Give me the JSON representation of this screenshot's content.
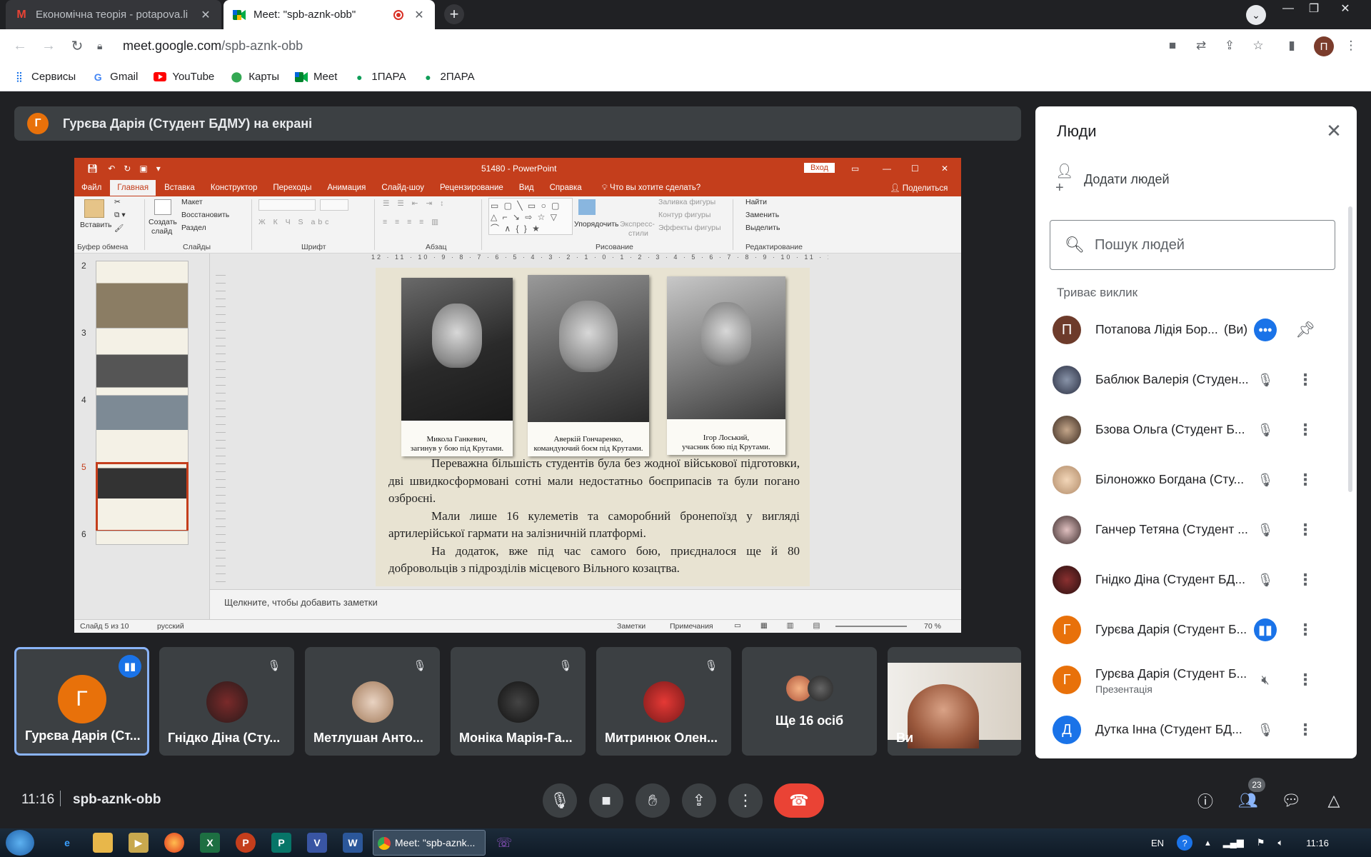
{
  "browser": {
    "tabs": [
      {
        "title": "Економічна теорія - potapova.li",
        "icon": "gmail-icon",
        "active": false
      },
      {
        "title": "Meet: \"spb-aznk-obb\"",
        "icon": "meet-icon",
        "active": true
      }
    ],
    "new_tab": "+",
    "url_host": "meet.google.com",
    "url_path": "/spb-aznk-obb",
    "profile_initial": "П",
    "bookmarks": [
      {
        "label": "Сервисы",
        "icon": "apps-grid-icon"
      },
      {
        "label": "Gmail",
        "icon": "google-icon"
      },
      {
        "label": "YouTube",
        "icon": "youtube-icon"
      },
      {
        "label": "Карты",
        "icon": "maps-pin-icon"
      },
      {
        "label": "Meet",
        "icon": "meet-icon"
      },
      {
        "label": "1ПАРА",
        "icon": "hangouts-icon"
      },
      {
        "label": "2ПАРА",
        "icon": "hangouts-icon"
      }
    ]
  },
  "meet": {
    "presenter_initial": "Г",
    "presenter_banner": "Гурєва Дарія (Студент БДМУ) на екрані",
    "time": "11:16",
    "code": "spb-aznk-obb",
    "people_count": "23",
    "tiles": [
      {
        "name": "Гурєва Дарія (Ст...",
        "initial": "Г",
        "speaking": true
      },
      {
        "name": "Гнідко Діна (Сту...",
        "muted": true
      },
      {
        "name": "Метлушан Анто...",
        "muted": true
      },
      {
        "name": "Моніка Марія-Га...",
        "muted": true
      },
      {
        "name": "Митринюк Олен...",
        "muted": true
      },
      {
        "name": "Ще 16 осіб"
      },
      {
        "name": "Ви"
      }
    ]
  },
  "ppt": {
    "window_title": "51480 - PowerPoint",
    "signin": "Вход",
    "menu": [
      "Файл",
      "Главная",
      "Вставка",
      "Конструктор",
      "Переходы",
      "Анимация",
      "Слайд-шоу",
      "Рецензирование",
      "Вид",
      "Справка"
    ],
    "tellme": "Что вы хотите сделать?",
    "share": "Поделиться",
    "ribbon": {
      "paste": "Вставить",
      "clipboard": "Буфер обмена",
      "new_slide_1": "Создать",
      "new_slide_2": "слайд",
      "layout": "Макет",
      "reset": "Восстановить",
      "section": "Раздел",
      "slides": "Слайды",
      "font": "Шрифт",
      "paragraph": "Абзац",
      "arrange": "Упорядочить",
      "quick_styles_1": "Экспресс-",
      "quick_styles_2": "стили",
      "fill": "Заливка фигуры",
      "outline": "Контур фигуры",
      "effects": "Эффекты фигуры",
      "drawing": "Рисование",
      "find": "Найти",
      "replace": "Заменить",
      "select": "Выделить",
      "editing": "Редактирование"
    },
    "thumb_numbers": [
      "2",
      "3",
      "4",
      "5",
      "6"
    ],
    "ruler": "12 · 11 · 10 · 9 · 8 · 7 · 6 · 5 · 4 · 3 · 2 · 1 · 0 · 1 · 2 · 3 · 4 · 5 · 6 · 7 · 8 · 9 · 10 · 11 · 12",
    "photos": [
      {
        "caption_1": "Микола Ганкевич,",
        "caption_2": "загинув у бою під Крутами."
      },
      {
        "caption_1": "Аверкій Гончаренко,",
        "caption_2": "командуючий боєм під Крутами."
      },
      {
        "caption_1": "Ігор Лоський,",
        "caption_2": "учасник бою під Крутами."
      }
    ],
    "paragraphs": [
      "Переважна більшість студентів була без жодної військової підготовки, дві швидкосформовані сотні мали недостатньо боєприпасів та були погано озброєні.",
      "Мали лише 16 кулеметів та саморобний бронепоїзд у вигляді артилерійської гармати на залізничній платформі.",
      "На додаток, вже під час самого бою, приєдналося ще й 80 добровольців з підрозділів місцевого Вільного козацтва."
    ],
    "notes_placeholder": "Щелкните, чтобы добавить заметки",
    "status_slide": "Слайд 5 из 10",
    "status_lang": "русский",
    "status_notes": "Заметки",
    "status_comments": "Примечания",
    "zoom": "70 %"
  },
  "people": {
    "title": "Люди",
    "add": "Додати людей",
    "search_placeholder": "Пошук людей",
    "section": "Триває виклик",
    "list": [
      {
        "name": "Потапова Лідія Бор...",
        "you": "(Ви)",
        "initial": "П",
        "avatar_color": "#6d3b2b",
        "mic": "more-dots",
        "action": "pin"
      },
      {
        "name": "Баблюк Валерія (Студен...",
        "initial": "",
        "avatar_color": "#3b3f52",
        "mic": "muted"
      },
      {
        "name": "Бзова Ольга (Студент Б...",
        "initial": "",
        "avatar_color": "#5a4a3e",
        "mic": "muted"
      },
      {
        "name": "Білоножко Богдана (Сту...",
        "initial": "",
        "avatar_color": "#c9a98b",
        "mic": "muted"
      },
      {
        "name": "Ганчер Тетяна (Студент ...",
        "initial": "",
        "avatar_color": "#4a3b3b",
        "mic": "muted"
      },
      {
        "name": "Гнідко Діна (Студент БД...",
        "initial": "",
        "avatar_color": "#3a2020",
        "mic": "muted"
      },
      {
        "name": "Гурєва Дарія (Студент Б...",
        "initial": "Г",
        "avatar_color": "#e8710a",
        "mic": "active"
      },
      {
        "name": "Гурєва Дарія (Студент Б...",
        "sub": "Презентація",
        "initial": "Г",
        "avatar_color": "#e8710a",
        "mic": "presenting"
      },
      {
        "name": "Дутка Інна (Студент БД...",
        "initial": "Д",
        "avatar_color": "#1a73e8",
        "mic": "muted"
      }
    ]
  },
  "taskbar": {
    "chrome_label": "Meet: \"spb-aznk...",
    "lang": "EN",
    "clock": "11:16"
  }
}
